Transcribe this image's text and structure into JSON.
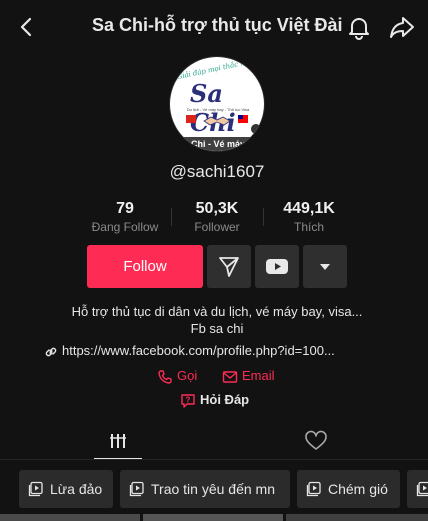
{
  "header": {
    "title": "Sa Chi-hỗ trợ thủ tục Việt Đài",
    "back_icon": "chevron-left-icon",
    "bell_icon": "bell-icon",
    "share_icon": "share-arrow-icon"
  },
  "avatar": {
    "tagline": "Giải đáp mọi thắc mắc",
    "logo_text": "Sa Chi",
    "sub_text": "Du lịch - Vé máy bay - Thủ tục Visa",
    "caption": "Chi - Vé máy"
  },
  "profile": {
    "username": "@sachi1607"
  },
  "stats": [
    {
      "value": "79",
      "label": "Đang Follow"
    },
    {
      "value": "50,3K",
      "label": "Follower"
    },
    {
      "value": "449,1K",
      "label": "Thích"
    }
  ],
  "actions": {
    "follow_label": "Follow",
    "message_icon": "send-message-icon",
    "youtube_icon": "youtube-icon",
    "more_icon": "caret-down-icon"
  },
  "bio": {
    "line1": "Hỗ trợ thủ tục di dân và du lịch, vé máy bay, visa...",
    "line2": "Fb sa chi",
    "link": "https://www.facebook.com/profile.php?id=100..."
  },
  "contact": {
    "call_label": "Gọi",
    "email_label": "Email",
    "qa_label": "Hỏi Đáp"
  },
  "tabs": [
    {
      "icon": "grid-videos-icon",
      "active": true
    },
    {
      "icon": "heart-liked-icon",
      "active": false
    }
  ],
  "playlists": [
    {
      "label": "Lừa đảo"
    },
    {
      "label": "Trao tin yêu đến mn"
    },
    {
      "label": "Chém gió"
    },
    {
      "label": ""
    }
  ],
  "colors": {
    "background": "#121212",
    "accent": "#fe2c55",
    "button_secondary": "#2f2f2f"
  }
}
